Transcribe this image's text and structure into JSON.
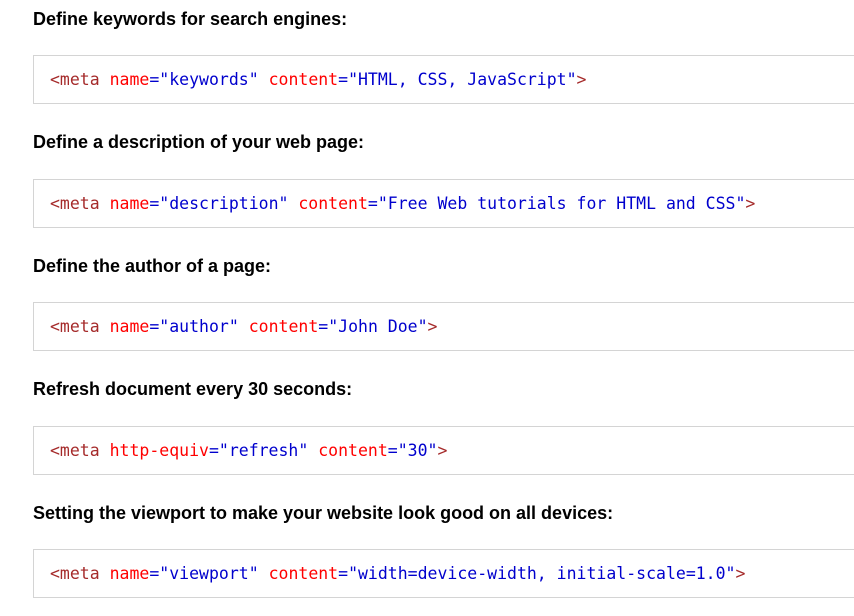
{
  "examples": [
    {
      "heading": "Define keywords for search engines:",
      "tag_open": "<meta",
      "attrs": [
        {
          "name": "name",
          "value": "\"keywords\""
        },
        {
          "name": "content",
          "value": "\"HTML, CSS, JavaScript\""
        }
      ],
      "tag_close": ">"
    },
    {
      "heading": "Define a description of your web page:",
      "tag_open": "<meta",
      "attrs": [
        {
          "name": "name",
          "value": "\"description\""
        },
        {
          "name": "content",
          "value": "\"Free Web tutorials for HTML and CSS\""
        }
      ],
      "tag_close": ">"
    },
    {
      "heading": "Define the author of a page:",
      "tag_open": "<meta",
      "attrs": [
        {
          "name": "name",
          "value": "\"author\""
        },
        {
          "name": "content",
          "value": "\"John Doe\""
        }
      ],
      "tag_close": ">"
    },
    {
      "heading": "Refresh document every 30 seconds:",
      "tag_open": "<meta",
      "attrs": [
        {
          "name": "http-equiv",
          "value": "\"refresh\""
        },
        {
          "name": "content",
          "value": "\"30\""
        }
      ],
      "tag_close": ">"
    },
    {
      "heading": "Setting the viewport to make your website look good on all devices:",
      "tag_open": "<meta",
      "attrs": [
        {
          "name": "name",
          "value": "\"viewport\""
        },
        {
          "name": "content",
          "value": "\"width=device-width, initial-scale=1.0\""
        }
      ],
      "tag_close": ">"
    }
  ],
  "syntax_colors": {
    "tag": "#a52a2a",
    "attribute": "#ff0000",
    "value": "#0000cd"
  }
}
